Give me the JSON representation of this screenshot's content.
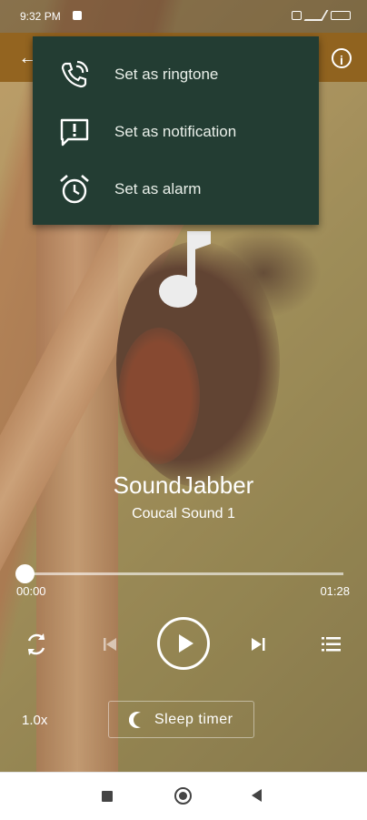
{
  "status_bar": {
    "time": "9:32 PM"
  },
  "menu": {
    "items": [
      {
        "label": "Set as ringtone",
        "icon": "phone-ringing-icon"
      },
      {
        "label": "Set as notification",
        "icon": "notification-alert-icon"
      },
      {
        "label": "Set as alarm",
        "icon": "alarm-clock-icon"
      }
    ]
  },
  "player": {
    "title": "SoundJabber",
    "track": "Coucal Sound 1",
    "current_time": "00:00",
    "total_time": "01:28",
    "progress": 0,
    "speed": "1.0x",
    "sleep_timer_label": "Sleep timer"
  },
  "colors": {
    "menu_background": "#233d33",
    "app_bar": "#8c5a14",
    "text_on_dark": "#ffffff"
  }
}
